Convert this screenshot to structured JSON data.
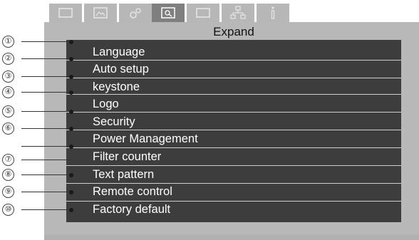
{
  "tabs": [
    {
      "icon": "display-icon",
      "active": false
    },
    {
      "icon": "picture-icon",
      "active": false
    },
    {
      "icon": "gears-icon",
      "active": false
    },
    {
      "icon": "expand-icon",
      "active": true
    },
    {
      "icon": "screen-icon",
      "active": false
    },
    {
      "icon": "network-icon",
      "active": false
    },
    {
      "icon": "info-icon",
      "active": false
    }
  ],
  "menu": {
    "title": "Expand",
    "items": [
      {
        "label": ""
      },
      {
        "label": "Language"
      },
      {
        "label": "Auto setup"
      },
      {
        "label": "keystone"
      },
      {
        "label": "Logo"
      },
      {
        "label": "Security"
      },
      {
        "label": "Power Management"
      },
      {
        "label": "Filter counter"
      },
      {
        "label": "Text pattern"
      },
      {
        "label": "Remote control"
      },
      {
        "label": "Factory default"
      }
    ]
  },
  "callouts": [
    "①",
    "②",
    "③",
    "④",
    "⑤",
    "⑥",
    "⑦",
    "⑧",
    "⑨",
    "⑩"
  ]
}
